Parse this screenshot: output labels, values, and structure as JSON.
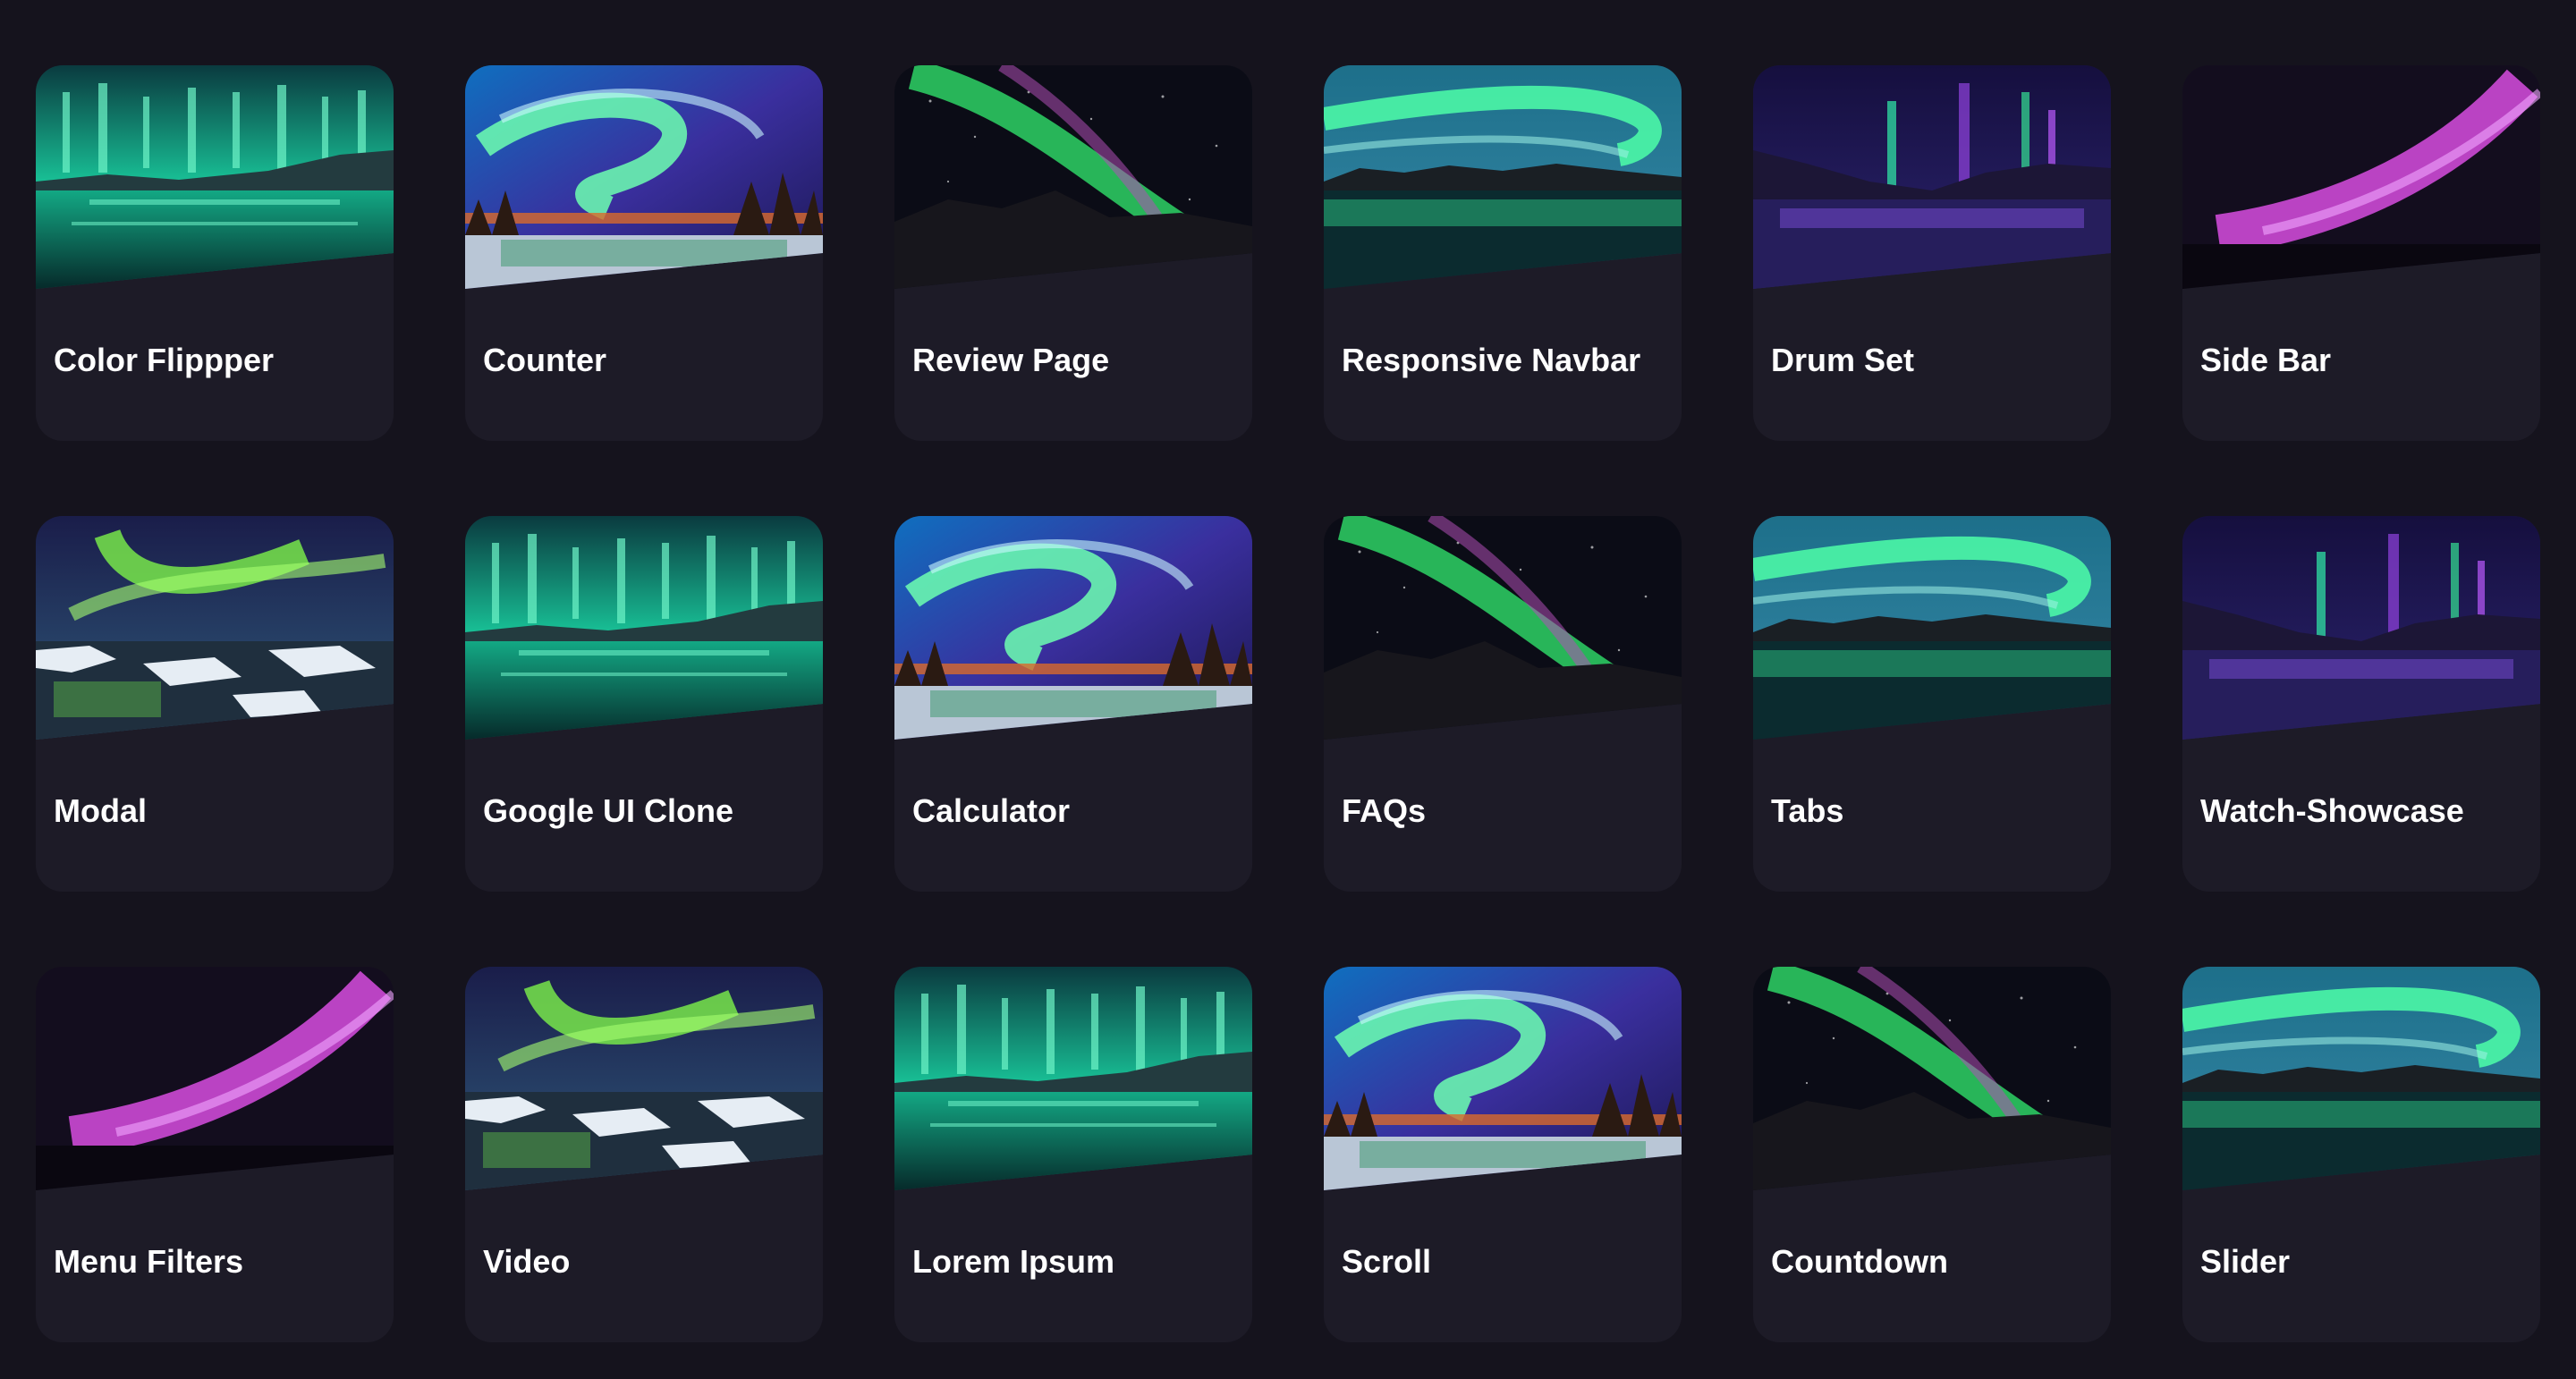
{
  "projects": [
    {
      "title": "Color Flippper",
      "thumbnail": "aurora-teal-lake"
    },
    {
      "title": "Counter",
      "thumbnail": "aurora-swirl-forest"
    },
    {
      "title": "Review Page",
      "thumbnail": "aurora-green-mountains"
    },
    {
      "title": "Responsive Navbar",
      "thumbnail": "aurora-arc-reflection"
    },
    {
      "title": "Drum Set",
      "thumbnail": "aurora-violet-fjord"
    },
    {
      "title": "Side Bar",
      "thumbnail": "aurora-pink-streak"
    },
    {
      "title": "Modal",
      "thumbnail": "aurora-lime-ice"
    },
    {
      "title": "Google UI Clone",
      "thumbnail": "aurora-teal-lake"
    },
    {
      "title": "Calculator",
      "thumbnail": "aurora-swirl-forest"
    },
    {
      "title": "FAQs",
      "thumbnail": "aurora-green-mountains"
    },
    {
      "title": "Tabs",
      "thumbnail": "aurora-arc-reflection"
    },
    {
      "title": "Watch-Showcase",
      "thumbnail": "aurora-violet-fjord"
    },
    {
      "title": "Menu Filters",
      "thumbnail": "aurora-pink-streak"
    },
    {
      "title": "Video",
      "thumbnail": "aurora-lime-ice"
    },
    {
      "title": "Lorem Ipsum",
      "thumbnail": "aurora-teal-lake"
    },
    {
      "title": "Scroll",
      "thumbnail": "aurora-swirl-forest"
    },
    {
      "title": "Countdown",
      "thumbnail": "aurora-green-mountains"
    },
    {
      "title": "Slider",
      "thumbnail": "aurora-arc-reflection"
    }
  ],
  "colors": {
    "page_background": "#15131d",
    "card_background": "#1d1b27",
    "title_text": "#ffffff"
  }
}
